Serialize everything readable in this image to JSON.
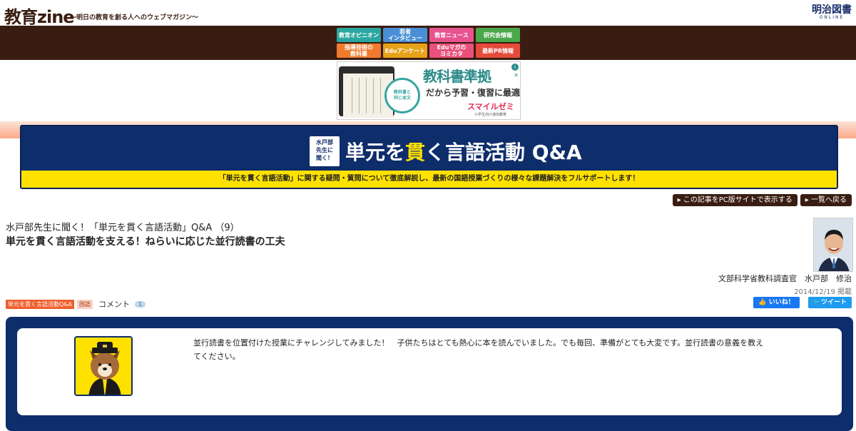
{
  "header": {
    "site_logo": "教育zine",
    "site_tagline": "～明日の教育を創る人へのウェブマガジン～",
    "publisher_name": "明治図書",
    "publisher_sub": "ONLINE"
  },
  "nav": {
    "items": [
      {
        "label": "教育オピニオン",
        "color": "#2aa7a0"
      },
      {
        "label": "若者\nインタビュー",
        "color": "#4a8fd6"
      },
      {
        "label": "教育ニュース",
        "color": "#e8538f"
      },
      {
        "label": "研究会情報",
        "color": "#4aa84a"
      },
      {
        "label": "指導技術の\n教科書",
        "color": "#f07a2e"
      },
      {
        "label": "Eduアンケート",
        "color": "#e7a21b"
      },
      {
        "label": "Eduマガの\nヨミカタ",
        "color": "#e9507a"
      },
      {
        "label": "最新PR情報",
        "color": "#e54b3b"
      }
    ]
  },
  "ad": {
    "headline": "教科書準拠",
    "subline": "だから予習・復習に最適",
    "circle_text": "教科書と\n同じ本文",
    "brand": "スマイルゼミ",
    "brand_sub": "小学生向け通信教育",
    "info_icon": "info-icon",
    "close_icon": "close-icon"
  },
  "banner": {
    "badge": "水戸部\n先生に\n聞く！",
    "title_pre": "単元を",
    "title_hl": "貫",
    "title_post": "く言語活動 Q&A",
    "strip": "「単元を貫く言語活動」に関する疑問・質問について徹底解説し、最新の国語授業づくりの様々な課題解決をフルサポートします！",
    "accent": "#ffe100",
    "bg": "#0e2d6b"
  },
  "actions": {
    "pc_view": "この記事をPC版サイトで表示する",
    "back_list": "一覧へ戻る"
  },
  "article": {
    "series": "水戸部先生に聞く！「単元を貫く言語活動」Q&A （9）",
    "title": "単元を貫く言語活動を支える！ねらいに応じた並行読書の工夫",
    "author": "文部科学省教科調査官　水戸部　修治",
    "date": "2014/12/19 掲載",
    "tag_series": "単元を貫く言語活動Q&A",
    "tag_subject": "国語",
    "comment_label": "コメント",
    "comment_count": "1"
  },
  "share": {
    "facebook": "いいね！",
    "twitter": "ツイート"
  },
  "qa": {
    "question": "並行読書を位置付けた授業にチャレンジしてみました！　子供たちはとても熱心に本を読んでいました。でも毎回、準備がとても大変です。並行読書の意義を教えてください。"
  }
}
